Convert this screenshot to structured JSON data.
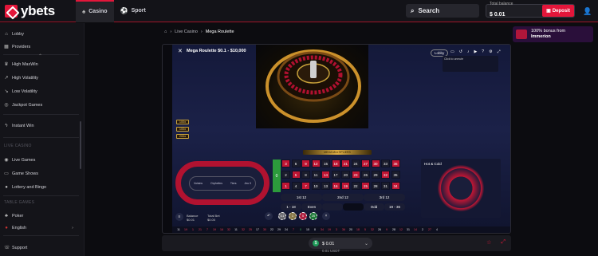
{
  "header": {
    "brand": "ybets",
    "tabs": [
      {
        "label": "Casino",
        "icon": "casino-icon"
      },
      {
        "label": "Sport",
        "icon": "sport-icon"
      }
    ],
    "search_label": "Search",
    "balance_label": "Total balance",
    "balance_value": "$ 0.01",
    "deposit_label": "Deposit"
  },
  "sidebar": {
    "top": [
      {
        "label": "Lobby"
      },
      {
        "label": "Providers"
      }
    ],
    "categories": [
      {
        "label": "High MaxWin"
      },
      {
        "label": "High Volatility"
      },
      {
        "label": "Low Volatility"
      },
      {
        "label": "Jackpot Games"
      }
    ],
    "instant": {
      "label": "Instant Win"
    },
    "live_header": "LIVE CASINO",
    "live": [
      {
        "label": "Live Games"
      },
      {
        "label": "Game Shows"
      },
      {
        "label": "Lottery and Bingo"
      }
    ],
    "table_header": "TABLE GAMES",
    "table": [
      {
        "label": "Poker"
      }
    ],
    "language": "English",
    "support": "Support"
  },
  "promo": {
    "line1": "100% bonus from",
    "line2": "Immerion"
  },
  "breadcrumb": {
    "live_casino": "Live Casino",
    "current": "Mega Roulette"
  },
  "game": {
    "title": "Mega Roulette $0.1 - $10,000",
    "lobby": "Lobby",
    "tooltip": "Click to unmute",
    "multipliers": [
      "100x",
      "100x",
      "200x"
    ],
    "banner": "MEGA MULTIPLIERS",
    "race_labels": [
      "Voisins",
      "Orphelins",
      "Tiers",
      "Jeu 0"
    ],
    "zero": "0",
    "grid": [
      [
        "3",
        "6",
        "9",
        "12",
        "15",
        "18",
        "21",
        "24",
        "27",
        "30",
        "33",
        "36"
      ],
      [
        "2",
        "5",
        "8",
        "11",
        "14",
        "17",
        "20",
        "23",
        "26",
        "29",
        "32",
        "35"
      ],
      [
        "1",
        "4",
        "7",
        "10",
        "13",
        "16",
        "19",
        "22",
        "25",
        "28",
        "31",
        "34"
      ]
    ],
    "dozens": [
      "1st 12",
      "2nd 12",
      "3rd 12"
    ],
    "outside": [
      "1 - 18",
      "Even",
      "Odd",
      "19 - 36"
    ],
    "stats_title": "Hot & Cold",
    "chips": [
      "0.1",
      "1",
      "5",
      "25"
    ],
    "balance_label": "Balance",
    "balance_value": "$0.01",
    "totalbet_label": "Total Bet",
    "totalbet_value": "$0.00",
    "history": [
      "11",
      "19",
      "1",
      "21",
      "7",
      "19",
      "16",
      "32",
      "11",
      "32",
      "25",
      "17",
      "30",
      "22",
      "29",
      "24",
      "7",
      "0",
      "15",
      "8",
      "34",
      "19",
      "3",
      "36",
      "20",
      "18",
      "5",
      "32",
      "26",
      "9",
      "28",
      "12",
      "31",
      "14",
      "2",
      "27",
      "4"
    ]
  },
  "wallet": {
    "amount": "$ 0.01",
    "currency": "0.01 USDT"
  },
  "colors": {
    "accent": "#e3163a",
    "table_red": "#c01634",
    "zero_green": "#2c9b3c"
  }
}
